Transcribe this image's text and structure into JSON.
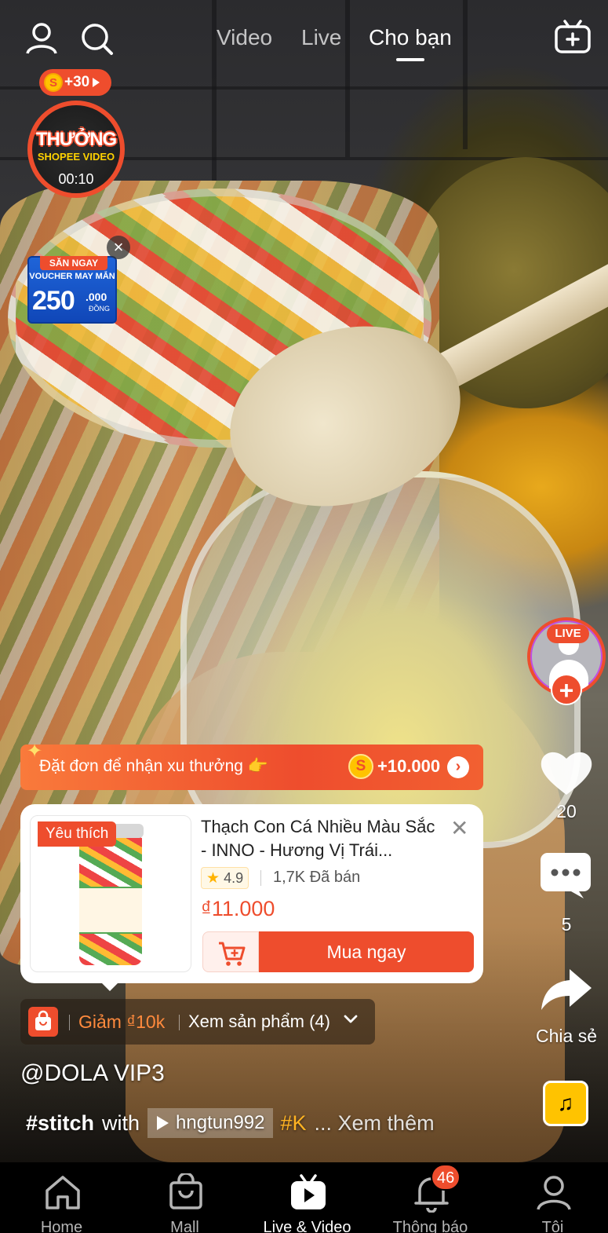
{
  "top_bar": {
    "tabs": [
      {
        "label": "Video",
        "active": false
      },
      {
        "label": "Live",
        "active": false
      },
      {
        "label": "Cho bạn",
        "active": true
      }
    ]
  },
  "reward_widget": {
    "coin_bonus": "+30",
    "title": "THƯỞNG",
    "subtitle": "SHOPEE VIDEO",
    "timer": "00:10"
  },
  "voucher": {
    "tag": "SĂN NGAY",
    "line": "VOUCHER MAY MẮN",
    "amount": "250",
    "suffix": ".000",
    "unit": "ĐỒNG"
  },
  "creator": {
    "live_badge": "LIVE"
  },
  "actions": {
    "likes": "20",
    "comments": "5",
    "share_label": "Chia sẻ"
  },
  "promo": {
    "text": "Đặt đơn để nhận xu thưởng 👉",
    "coin_symbol": "S",
    "amount": "+10.000"
  },
  "product": {
    "tag": "Yêu thích",
    "name": "Thạch Con Cá Nhiều Màu Sắc - INNO - Hương Vị Trái...",
    "rating": "4.9",
    "sold": "1,7K Đã bán",
    "price": "₫11.000",
    "buy_label": "Mua ngay"
  },
  "shop_strip": {
    "discount": "Giảm ₫10k",
    "view_products": "Xem sản phẩm (4)"
  },
  "caption": {
    "username": "@DOLA VIP3",
    "hashtag": "#stitch",
    "with": "with",
    "stitch_user": "hngtun992",
    "tag_k": "#K",
    "more": "... Xem thêm"
  },
  "bottom_nav": {
    "items": [
      {
        "label": "Home",
        "icon": "home-icon"
      },
      {
        "label": "Mall",
        "icon": "shopping-bag-icon"
      },
      {
        "label": "Live & Video",
        "icon": "live-video-icon",
        "active": true
      },
      {
        "label": "Thông báo",
        "icon": "bell-icon",
        "badge": "46"
      },
      {
        "label": "Tôi",
        "icon": "profile-icon"
      }
    ]
  },
  "colors": {
    "brand": "#ee4d2d",
    "coin": "#ffc300",
    "music": "#ffc300"
  }
}
